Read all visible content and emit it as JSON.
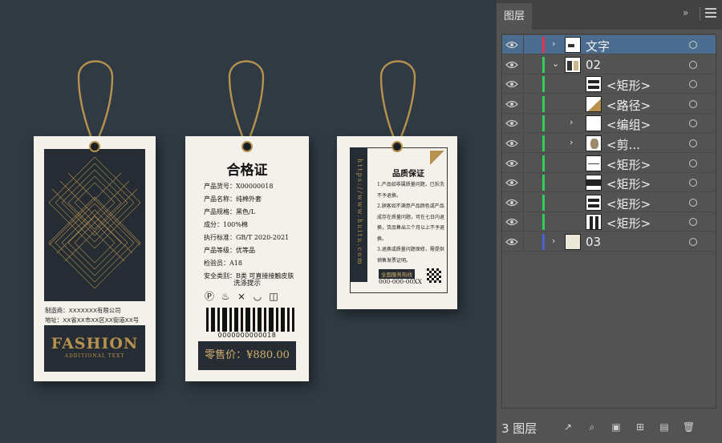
{
  "tag1": {
    "maker": "制造商：XXXXXXX有限公司",
    "address": "地址：XX省XX市XX区XX街道XX号",
    "brand": "FASHION",
    "subbrand": "ADDITIONAL TEXT"
  },
  "tag2": {
    "title": "合格证",
    "lines": [
      "产品货号：X00000018",
      "产品名称：纯棉外套",
      "产品规格：黑色/L",
      "成分：100%棉",
      "执行标准：GB/T 2020-2021",
      "产品等级：优等品",
      "检验员：A18",
      "安全类别：B类 可直接接触皮肤"
    ],
    "wash_title": "洗涤提示",
    "barcode_number": "0000000000018",
    "price": "零售价：¥880.00"
  },
  "tag3": {
    "url": "https://www.huitu.com",
    "title": "品质保证",
    "paragraphs": [
      "1.产品如非属质量问题，已拆洗不予退换。",
      "2.顾客如不满意产品颜色或产品成存在质量问题，可在七日内退换，货品售出三个月以上不予退换。",
      "3.退换或质量问题保修，需提供销售发票证明。"
    ],
    "hotline_label": "全国服务热线",
    "phone": "000-000-00XX"
  },
  "panel": {
    "tab": "图层",
    "count_label": "3 图层",
    "accent": "#4b6c8f",
    "layers": [
      {
        "name": "文字",
        "indent": 0,
        "arrow": "›",
        "bar": "#e8334a",
        "selected": true,
        "thumb": "text"
      },
      {
        "name": "02",
        "indent": 0,
        "arrow": "⌄",
        "bar": "#2fd05a",
        "selected": false,
        "thumb": "group"
      },
      {
        "name": "<矩形>",
        "indent": 1,
        "arrow": "",
        "bar": "#2fd05a",
        "selected": false,
        "thumb": "bars"
      },
      {
        "name": "<路径>",
        "indent": 1,
        "arrow": "",
        "bar": "#2fd05a",
        "selected": false,
        "thumb": "diag"
      },
      {
        "name": "<编组>",
        "indent": 1,
        "arrow": "›",
        "bar": "#2fd05a",
        "selected": false,
        "thumb": "blank"
      },
      {
        "name": "<剪...",
        "indent": 1,
        "arrow": "›",
        "bar": "#2fd05a",
        "selected": false,
        "thumb": "diamond"
      },
      {
        "name": "<矩形>",
        "indent": 1,
        "arrow": "",
        "bar": "#2fd05a",
        "selected": false,
        "thumb": "line"
      },
      {
        "name": "<矩形>",
        "indent": 1,
        "arrow": "",
        "bar": "#2fd05a",
        "selected": false,
        "thumb": "dark"
      },
      {
        "name": "<矩形>",
        "indent": 1,
        "arrow": "",
        "bar": "#2fd05a",
        "selected": false,
        "thumb": "bars"
      },
      {
        "name": "<矩形>",
        "indent": 1,
        "arrow": "",
        "bar": "#2fd05a",
        "selected": false,
        "thumb": "vbars"
      },
      {
        "name": "03",
        "indent": 0,
        "arrow": "›",
        "bar": "#4a62d8",
        "selected": false,
        "thumb": "paper"
      }
    ],
    "footer_icons": [
      "export-icon",
      "search-icon",
      "clipping-mask-icon",
      "sublayer-icon",
      "new-layer-icon",
      "trash-icon"
    ]
  }
}
